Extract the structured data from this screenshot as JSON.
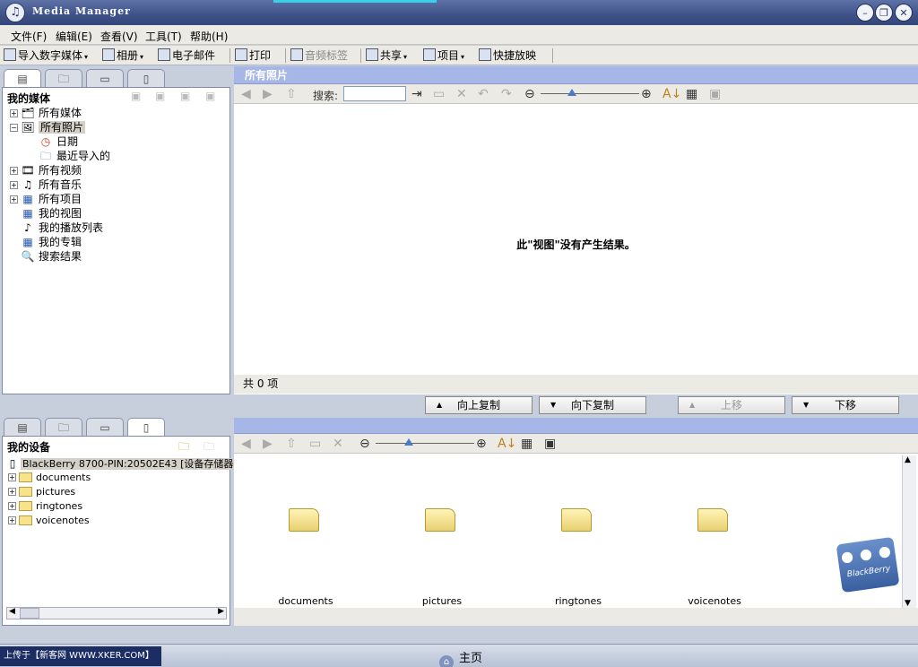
{
  "window": {
    "title": "Media Manager",
    "controls": {
      "minimize": "–",
      "restore": "❐",
      "close": "✕"
    }
  },
  "menu": [
    "文件(F)",
    "编辑(E)",
    "查看(V)",
    "工具(T)",
    "帮助(H)"
  ],
  "toolbar": {
    "import": "导入数字媒体",
    "album": "相册",
    "email": "电子邮件",
    "print": "打印",
    "audio_tag": "音频标签",
    "share": "共享",
    "project": "项目",
    "slideshow": "快捷放映"
  },
  "library": {
    "title": "我的媒体",
    "items": [
      "所有媒体",
      "所有照片",
      "日期",
      "最近导入的",
      "所有视频",
      "所有音乐",
      "所有项目",
      "我的视图",
      "我的播放列表",
      "我的专辑",
      "搜索结果"
    ]
  },
  "content": {
    "header": "所有照片",
    "search_label": "搜索:",
    "search_value": "",
    "empty_message": "此\"视图\"没有产生结果。",
    "status": "共 0 项"
  },
  "transfer": {
    "copy_up": "向上复制",
    "copy_down": "向下复制",
    "move_up": "上移",
    "move_down": "下移"
  },
  "devices": {
    "title": "我的设备",
    "device": "BlackBerry 8700-PIN:20502E43 [设备存储器]",
    "folders": [
      "documents",
      "pictures",
      "ringtones",
      "voicenotes"
    ]
  },
  "device_view": {
    "folders": [
      "documents",
      "pictures",
      "ringtones",
      "voicenotes"
    ]
  },
  "branding": {
    "logo_text": "BlackBerry"
  },
  "taskbar": {
    "home": "主页",
    "left_text": "上传于【新客网 WWW.XKER.COM】"
  }
}
